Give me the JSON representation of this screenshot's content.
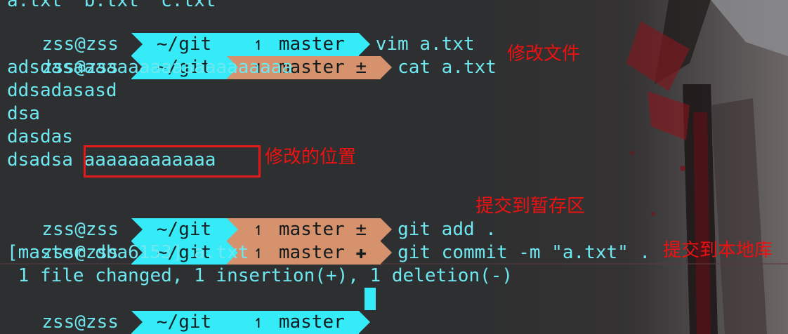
{
  "colors": {
    "background": "#2e2f30",
    "text_cyan": "#6ee8f0",
    "segment_dir": "#35ebf7",
    "segment_clean": "#35ebf7",
    "segment_dirty": "#d6926c",
    "annotation_red": "#ee1111"
  },
  "top_partial": "a.txt  b.txt  c.txt",
  "prompt": {
    "user": "zss@zss",
    "dir": "~/git",
    "branch": "master",
    "branch_icon": "git-branch-icon"
  },
  "lines": [
    {
      "state": "clean",
      "badge": "",
      "command": "vim a.txt"
    },
    {
      "state": "dirty",
      "badge": "±",
      "command": "cat a.txt"
    },
    {
      "state": "dirty",
      "badge": "±",
      "command": "git add ."
    },
    {
      "state": "dirty",
      "badge": "✚",
      "command": "git commit -m \"a.txt\" ."
    },
    {
      "state": "clean",
      "badge": "",
      "command": ""
    }
  ],
  "file_content": [
    "adsdasaaaaaaaaaaaaaaaaaaaa",
    "ddsadasasd",
    "dsa",
    "dasdas",
    "dsadsa aaaaaaaaaaaa"
  ],
  "commit_output": [
    "[master dba6153] a.txt",
    " 1 file changed, 1 insertion(+), 1 deletion(-)"
  ],
  "annotations": {
    "modify_file": "修改文件",
    "modify_location": "修改的位置",
    "commit_to_staging": "提交到暂存区",
    "commit_to_local_repo": "提交到本地库"
  }
}
